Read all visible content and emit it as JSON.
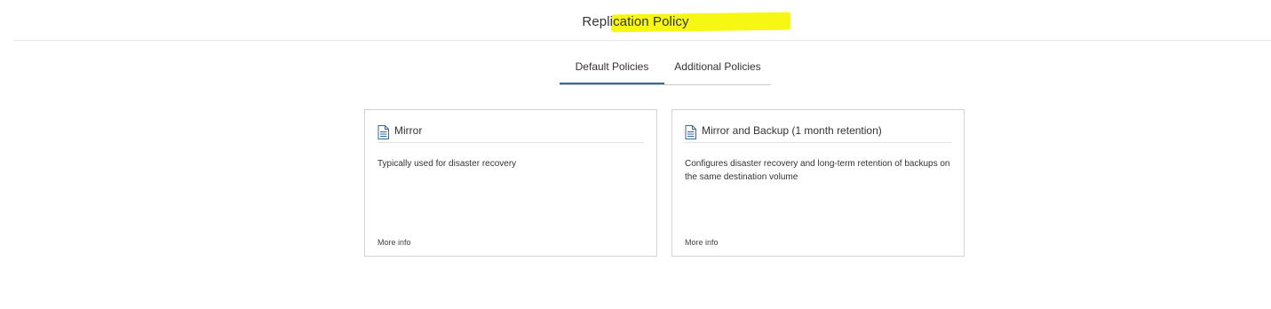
{
  "page": {
    "title": "Replication Policy"
  },
  "tabs": [
    {
      "label": "Default Policies",
      "active": true
    },
    {
      "label": "Additional Policies",
      "active": false
    }
  ],
  "policies": [
    {
      "title": "Mirror",
      "description": "Typically used for disaster recovery",
      "more_info": "More info",
      "icon": "document-icon"
    },
    {
      "title": "Mirror and Backup (1 month retention)",
      "description": "Configures disaster recovery and long-term retention of backups on the same destination volume",
      "more_info": "More info",
      "icon": "document-icon"
    }
  ],
  "colors": {
    "highlight": "#f5f700",
    "accent": "#2f6aa1",
    "border": "#d4d4d4"
  }
}
